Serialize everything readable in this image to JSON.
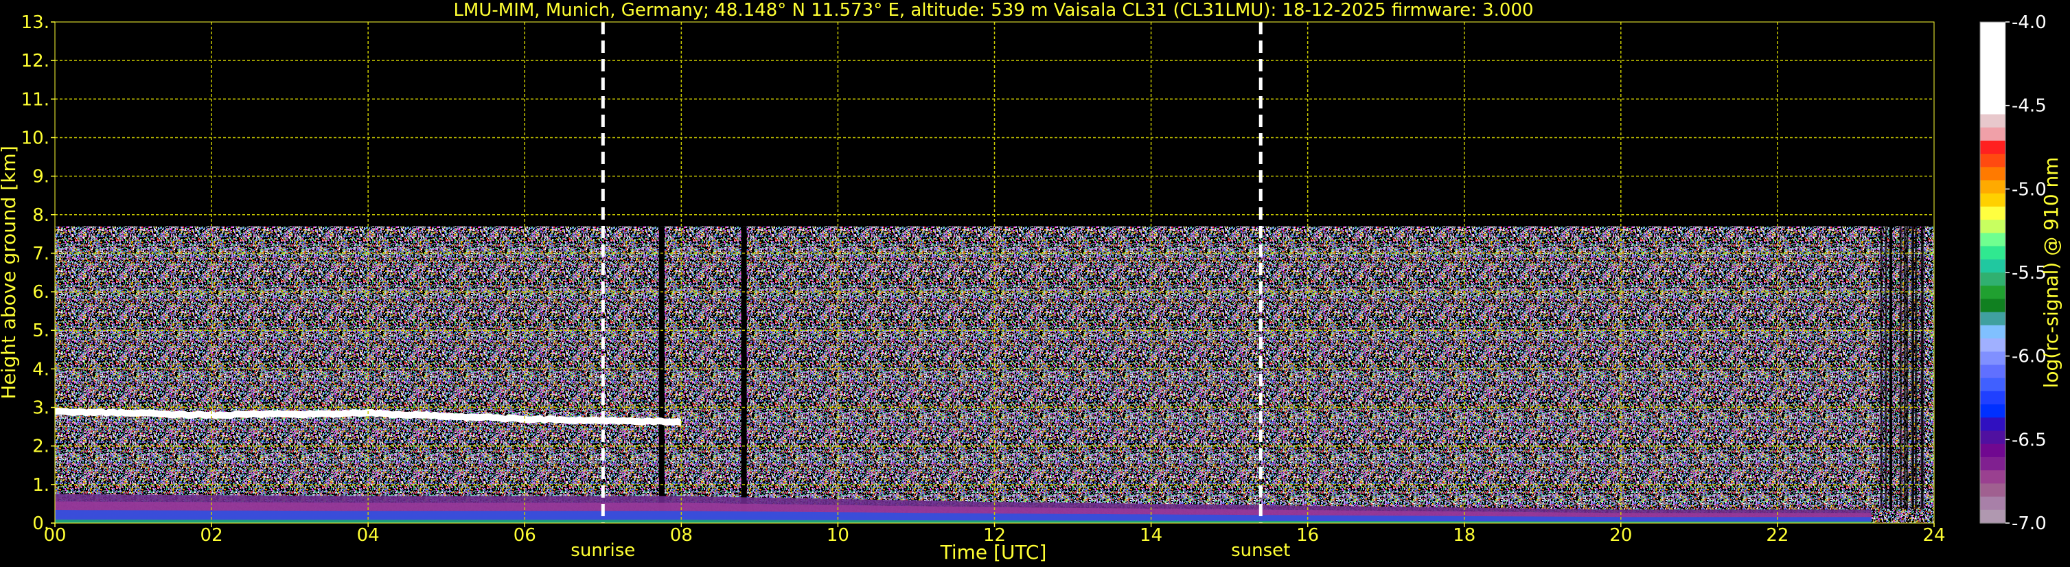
{
  "chart_data": {
    "type": "heatmap",
    "title": "LMU-MIM, Munich, Germany; 48.148° N 11.573° E, altitude: 539 m    Vaisala CL31 (CL31LMU): 18-12-2025    firmware: 3.000",
    "xlabel": "Time [UTC]",
    "ylabel": "Height above ground [km]",
    "xlim": [
      0,
      24
    ],
    "ylim": [
      0,
      13
    ],
    "xticks": [
      "00",
      "02",
      "04",
      "06",
      "08",
      "10",
      "12",
      "14",
      "16",
      "18",
      "20",
      "22",
      "24"
    ],
    "xtick_values": [
      0,
      2,
      4,
      6,
      8,
      10,
      12,
      14,
      16,
      18,
      20,
      22,
      24
    ],
    "yticks": [
      "0.",
      "1.",
      "2.",
      "3.",
      "4.",
      "5.",
      "6.",
      "7.",
      "8.",
      "9.",
      "10.",
      "11.",
      "12.",
      "13."
    ],
    "ytick_values": [
      0,
      1,
      2,
      3,
      4,
      5,
      6,
      7,
      8,
      9,
      10,
      11,
      12,
      13
    ],
    "grid": true,
    "grid_color": "#c8c800",
    "background": "#000000",
    "text_color": "#ffff33",
    "data_top_km": 7.7,
    "annotations": [
      {
        "label": "sunrise",
        "time": 7.0
      },
      {
        "label": "sunset",
        "time": 15.4
      }
    ],
    "cloud_layer": {
      "color": "#ffffff",
      "description_points": [
        [
          0.0,
          2.9
        ],
        [
          2.0,
          2.8
        ],
        [
          4.0,
          2.85
        ],
        [
          6.0,
          2.7
        ],
        [
          7.0,
          2.65
        ],
        [
          8.0,
          2.62
        ]
      ]
    },
    "data_gaps": [
      7.75,
      8.8
    ],
    "boundary_layer_top_km": [
      [
        0,
        0.75
      ],
      [
        4,
        0.7
      ],
      [
        8,
        0.7
      ],
      [
        12,
        0.55
      ],
      [
        16,
        0.45
      ],
      [
        20,
        0.35
      ],
      [
        23.2,
        0.35
      ]
    ],
    "colorbar": {
      "label": "log(rc-signal) @ 910 nm",
      "min": -7.0,
      "max": -4.0,
      "ticks": [
        "-4.0",
        "-4.5",
        "-5.0",
        "-5.5",
        "-6.0",
        "-6.5",
        "-7.0"
      ],
      "tick_values": [
        -4.0,
        -4.5,
        -5.0,
        -5.5,
        -6.0,
        -6.5,
        -7.0
      ],
      "colors_top_to_bottom": [
        "#ffffff",
        "#ffffff",
        "#ffffff",
        "#ffffff",
        "#ffffff",
        "#ffffff",
        "#ffffff",
        "#e8c8cc",
        "#f0a0a8",
        "#ff2020",
        "#ff4a10",
        "#ff7a00",
        "#ffaa00",
        "#ffd000",
        "#ffff40",
        "#c8ff60",
        "#70ff90",
        "#30e890",
        "#20c8a0",
        "#30b070",
        "#20a030",
        "#108020",
        "#40a0a0",
        "#80c0ff",
        "#a0b0ff",
        "#8090ff",
        "#6070ff",
        "#4060ff",
        "#2040ff",
        "#0030ff",
        "#3010c0",
        "#5010a0",
        "#700890",
        "#802090",
        "#9a4090",
        "#a06090",
        "#a880a8",
        "#b098b0"
      ]
    }
  }
}
